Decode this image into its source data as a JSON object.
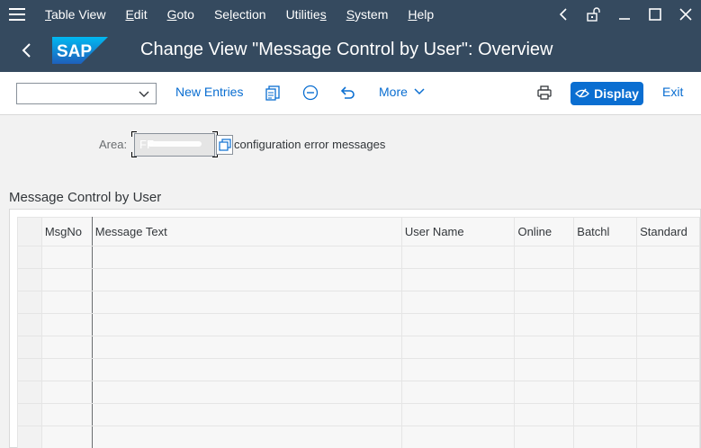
{
  "menu": {
    "items": [
      {
        "label": "Table View",
        "mnemonic": "T",
        "rest": "able View"
      },
      {
        "label": "Edit",
        "mnemonic": "E",
        "rest": "dit"
      },
      {
        "label": "Goto",
        "mnemonic": "G",
        "rest": "oto"
      },
      {
        "label": "Selection",
        "pre": "Se",
        "mnemonic": "l",
        "rest": "ection"
      },
      {
        "label": "Utilities",
        "pre": "Utilitie",
        "mnemonic": "s",
        "rest": ""
      },
      {
        "label": "System",
        "mnemonic": "S",
        "rest": "ystem"
      },
      {
        "label": "Help",
        "mnemonic": "H",
        "rest": "elp"
      }
    ]
  },
  "title": "Change View \"Message Control by User\": Overview",
  "logo_text": "SAP",
  "toolbar": {
    "command_field_value": "",
    "new_entries": "New Entries",
    "more": "More",
    "display": "Display",
    "exit": "Exit"
  },
  "area": {
    "label": "Area:",
    "value": "FF",
    "description": "configuration error messages"
  },
  "section_title": "Message Control by User",
  "table": {
    "columns": [
      "",
      "MsgNo",
      "Message Text",
      "User Name",
      "Online",
      "Batchl",
      "Standard"
    ],
    "row_count": 9
  },
  "colors": {
    "shell": "#354a5f",
    "accent": "#0a6ed1"
  }
}
